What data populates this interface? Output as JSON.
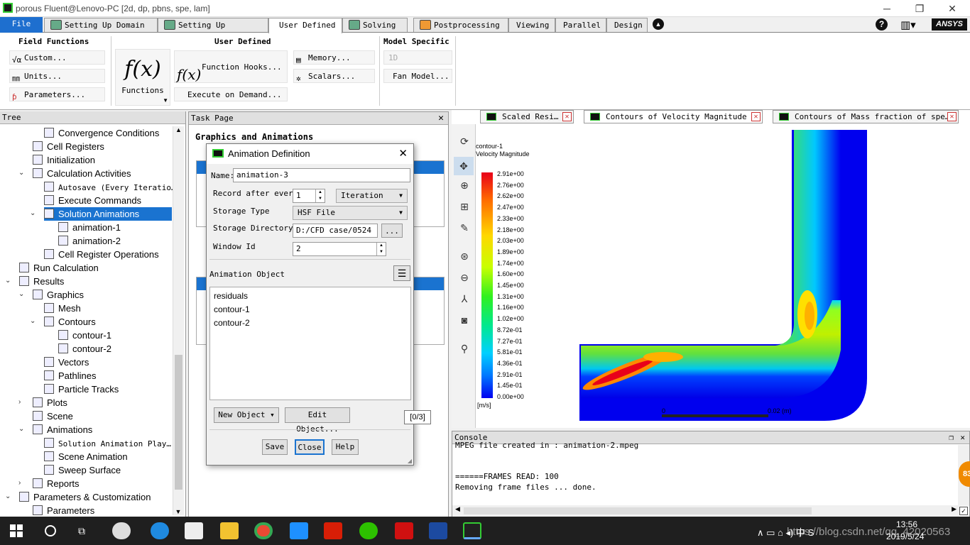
{
  "window": {
    "title": "porous Fluent@Lenovo-PC  [2d, dp, pbns, spe, lam]"
  },
  "tabs": [
    {
      "label": "File"
    },
    {
      "label": "Setting Up Domain"
    },
    {
      "label": "Setting Up Physics"
    },
    {
      "label": "User Defined"
    },
    {
      "label": "Solving"
    },
    {
      "label": "Postprocessing"
    },
    {
      "label": "Viewing"
    },
    {
      "label": "Parallel"
    },
    {
      "label": "Design"
    }
  ],
  "brand": "ANSYS",
  "ribbon": {
    "field_functions": {
      "title": "Field Functions",
      "custom": "Custom...",
      "units": "Units...",
      "parameters": "Parameters..."
    },
    "user_defined": {
      "title": "User Defined",
      "functions": "Functions",
      "function_hooks": "Function Hooks...",
      "execute_on_demand": "Execute on Demand...",
      "memory": "Memory...",
      "scalars": "Scalars..."
    },
    "model_specific": {
      "title": "Model Specific",
      "coupling": "1D Coupling...",
      "fan_model": "Fan Model..."
    }
  },
  "tree": {
    "title": "Tree",
    "items": [
      {
        "label": "Convergence Conditions"
      },
      {
        "label": "Cell Registers"
      },
      {
        "label": "Initialization"
      },
      {
        "label": "Calculation Activities"
      },
      {
        "label": "Autosave (Every Iteratio…"
      },
      {
        "label": "Execute Commands"
      },
      {
        "label": "Solution Animations"
      },
      {
        "label": "animation-1"
      },
      {
        "label": "animation-2"
      },
      {
        "label": "Cell Register Operations"
      },
      {
        "label": "Run Calculation"
      },
      {
        "label": "Results"
      },
      {
        "label": "Graphics"
      },
      {
        "label": "Mesh"
      },
      {
        "label": "Contours"
      },
      {
        "label": "contour-1"
      },
      {
        "label": "contour-2"
      },
      {
        "label": "Vectors"
      },
      {
        "label": "Pathlines"
      },
      {
        "label": "Particle Tracks"
      },
      {
        "label": "Plots"
      },
      {
        "label": "Scene"
      },
      {
        "label": "Animations"
      },
      {
        "label": "Solution Animation Play…"
      },
      {
        "label": "Scene Animation"
      },
      {
        "label": "Sweep Surface"
      },
      {
        "label": "Reports"
      },
      {
        "label": "Parameters & Customization"
      },
      {
        "label": "Parameters"
      }
    ]
  },
  "task": {
    "title": "Task Page",
    "heading": "Graphics and Animations"
  },
  "graphics": {
    "tabs": [
      {
        "label": "Scaled Resi…"
      },
      {
        "label": "Contours of Velocity Magnitude …"
      },
      {
        "label": "Contours of Mass fraction of spe…"
      }
    ],
    "contour_name": "contour-1",
    "field": "Velocity Magnitude",
    "legend": [
      "2.91e+00",
      "2.76e+00",
      "2.62e+00",
      "2.47e+00",
      "2.33e+00",
      "2.18e+00",
      "2.03e+00",
      "1.89e+00",
      "1.74e+00",
      "1.60e+00",
      "1.45e+00",
      "1.31e+00",
      "1.16e+00",
      "1.02e+00",
      "8.72e-01",
      "7.27e-01",
      "5.81e-01",
      "4.36e-01",
      "2.91e-01",
      "1.45e-01",
      "0.00e+00"
    ],
    "unit": "[m/s]",
    "scale_start": "0",
    "scale_end": "0.02 (m)"
  },
  "dialog": {
    "title": "Animation Definition",
    "name_label": "Name:",
    "name_value": "animation-3",
    "record_label": "Record after every",
    "record_value": "1",
    "record_unit": "Iteration",
    "storage_type_label": "Storage Type",
    "storage_type_value": "HSF File",
    "storage_dir_label": "Storage Directory",
    "storage_dir_value": "D:/CFD case/0524",
    "browse": "...",
    "window_id_label": "Window Id",
    "window_id_value": "2",
    "object_label": "Animation Object",
    "objects": [
      "residuals",
      "contour-1",
      "contour-2"
    ],
    "new_object": "New Object",
    "edit_object": "Edit Object...",
    "count": "[0/3]",
    "save": "Save",
    "close": "Close",
    "help": "Help"
  },
  "console": {
    "title": "Console",
    "lines": [
      "MPEG file created in : animation-2.mpeg",
      "",
      "======FRAMES READ:  100",
      "Removing frame files ... done."
    ]
  },
  "taskbar": {
    "time": "13:56",
    "date": "2019/5/24",
    "watermark": "https://blog.csdn.net/qq_42020563"
  },
  "badge": "83",
  "colors": {
    "accent": "#1a73d0",
    "file_tab": "#1e6fcf"
  }
}
